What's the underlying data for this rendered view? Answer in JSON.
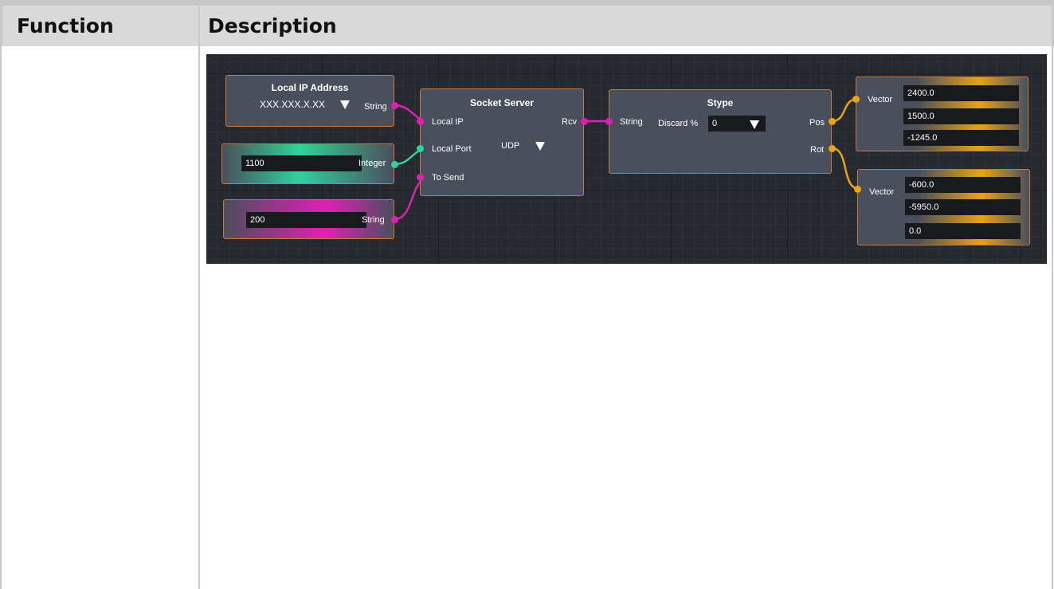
{
  "table": {
    "headers": {
      "function": "Function",
      "description": "Description"
    }
  },
  "graph": {
    "colors": {
      "string_wire": "#e020b5",
      "integer_wire": "#2ed49a",
      "vector_wire": "#e8a316",
      "node_border": "#c97a3a"
    },
    "local_ip_node": {
      "title": "Local IP Address",
      "value": "XXX.XXX.X.XX",
      "output": "String"
    },
    "integer_node": {
      "value": "1100",
      "output": "Integer"
    },
    "string_node": {
      "value": "200",
      "output": "String"
    },
    "socket_server_node": {
      "title": "Socket Server",
      "inputs": [
        "Local IP",
        "Local Port",
        "To Send"
      ],
      "protocol": "UDP",
      "output": "Rcv"
    },
    "stype_node": {
      "title": "Stype",
      "input": "String",
      "discard_label": "Discard %",
      "discard_value": "0",
      "outputs": [
        "Pos",
        "Rot"
      ]
    },
    "vector_pos_node": {
      "label": "Vector",
      "values": [
        "2400.0",
        "1500.0",
        "-1245.0"
      ]
    },
    "vector_rot_node": {
      "label": "Vector",
      "values": [
        "-600.0",
        "-5950.0",
        "0.0"
      ]
    }
  }
}
